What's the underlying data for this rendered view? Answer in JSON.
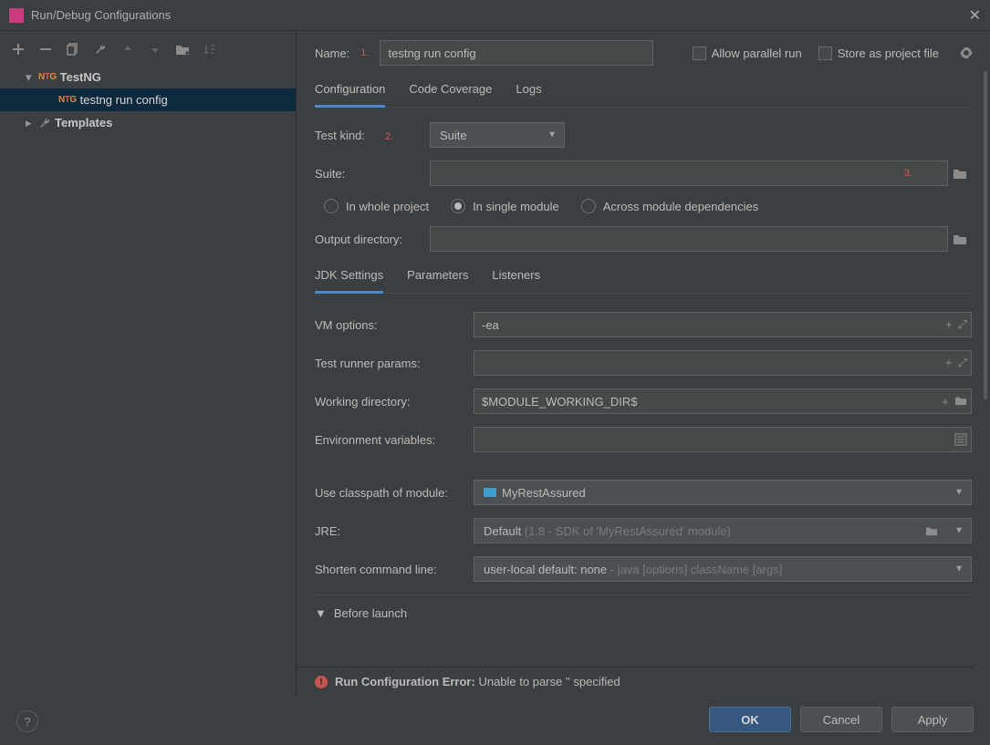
{
  "window": {
    "title": "Run/Debug Configurations"
  },
  "sidebar": {
    "nodes": [
      {
        "label": "TestNG",
        "icon": "NTG"
      },
      {
        "label": "testng run config",
        "icon": "NTG"
      },
      {
        "label": "Templates"
      }
    ]
  },
  "header": {
    "name_label": "Name:",
    "marker1": "1.",
    "name_value": "testng run config",
    "allow_parallel": "Allow parallel run",
    "store_as_project": "Store as project file"
  },
  "tabs": {
    "configuration": "Configuration",
    "code_coverage": "Code Coverage",
    "logs": "Logs"
  },
  "form": {
    "test_kind_label": "Test kind:",
    "marker2": "2.",
    "test_kind_value": "Suite",
    "suite_label": "Suite:",
    "marker3": "3.",
    "radio_whole": "In whole project",
    "radio_single": "In single module",
    "radio_across": "Across module dependencies",
    "output_dir_label": "Output directory:",
    "subtabs": {
      "jdk": "JDK Settings",
      "params": "Parameters",
      "listeners": "Listeners"
    },
    "vm_label": "VM options:",
    "vm_value": "-ea",
    "runner_label": "Test runner params:",
    "workdir_label": "Working directory:",
    "workdir_value": "$MODULE_WORKING_DIR$",
    "env_label": "Environment variables:",
    "classpath_label": "Use classpath of module:",
    "classpath_value": "MyRestAssured",
    "jre_label": "JRE:",
    "jre_value": "Default",
    "jre_hint": " (1.8 - SDK of 'MyRestAssured' module)",
    "shorten_label": "Shorten command line:",
    "shorten_value": "user-local default: none",
    "shorten_hint": " - java [options] className [args]",
    "before_launch": "Before launch"
  },
  "error": {
    "label": "Run Configuration Error:",
    "message": "Unable to parse '' specified"
  },
  "buttons": {
    "ok": "OK",
    "cancel": "Cancel",
    "apply": "Apply"
  }
}
